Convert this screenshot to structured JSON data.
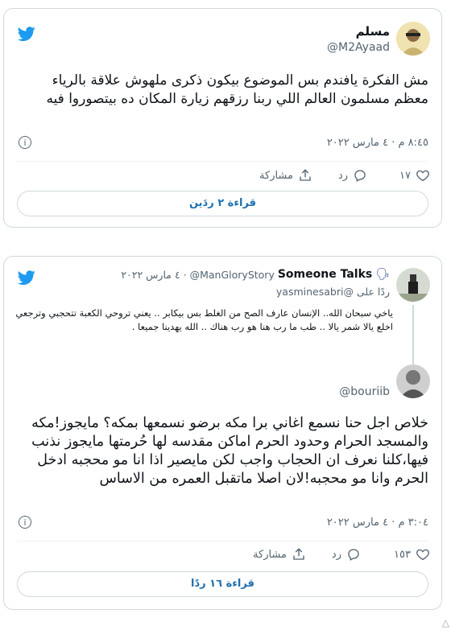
{
  "tweet1": {
    "name": "مسلم",
    "handle": "@M2Ayaad",
    "text": "مش الفكرة يافندم بس الموضوع بيكون ذكرى ملهوش علاقة بالرياء معظم مسلمون العالم اللي ربنا رزقهم زيارة المكان ده بيتصوروا فيه",
    "timestamp": "٨:٤٥ م · ٤ مارس ٢٠٢٢",
    "like_count": "١٧",
    "reply_label": "رد",
    "share_label": "مشاركة",
    "read_replies": "قراءة ٢ ردَين"
  },
  "tweet2": {
    "header_name": "Someone Talks",
    "header_handle": "@ManGloryStory",
    "header_date": "· ٤ مارس ٢٠٢٢",
    "reply_to": "ردًا على @yasminesabri",
    "quoted_text": "ياخي سبحان الله.. الإنسان عارف الصح من الغلط بس بيكابر .. يعني تروحي الكعبة تتحجبي وترجعي اخلع يالا شمر يالا .. طب ما رب هنا هو رب هناك .. الله يهدينا جميعا .",
    "reply_handle": "@bouriib",
    "text": "خلاص اجل حنا نسمع اغاني برا مكه برضو نسمعها بمكه؟ مايجوز!مكه والمسجد الحرام وحدود الحرم اماكن مقدسه لها حُرمتها مايجوز نذنب فيها،كلنا نعرف ان الحجاب واجب لكن مايصير اذا انا مو محجبه ادخل الحرم وانا مو محجبه!لان اصلا ماتقبل العمره من الاساس",
    "timestamp": "٣:٠٤ م · ٤ مارس ٢٠٢٢",
    "like_count": "١٥٣",
    "reply_label": "رد",
    "share_label": "مشاركة",
    "read_replies": "قراءة ١٦ ردًا"
  },
  "colors": {
    "brand": "#1d9bf0",
    "secondary_text": "#536471",
    "border": "#cfd9de"
  },
  "icons": [
    "twitter-bird-icon",
    "info-icon",
    "heart-icon",
    "reply-icon",
    "share-icon",
    "speaking-head-emoji"
  ]
}
